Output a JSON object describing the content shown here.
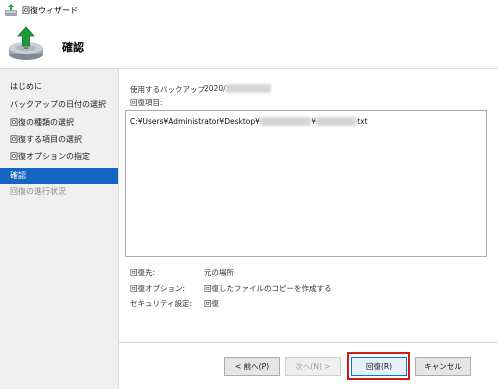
{
  "window": {
    "title": "回復ウィザード"
  },
  "header": {
    "title": "確認"
  },
  "nav": {
    "items": [
      {
        "label": "はじめに"
      },
      {
        "label": "バックアップの日付の選択"
      },
      {
        "label": "回復の種類の選択"
      },
      {
        "label": "回復する項目の選択"
      },
      {
        "label": "回復オプションの指定"
      },
      {
        "label": "確認"
      },
      {
        "label": "回復の進行状況"
      }
    ],
    "active_index": 5
  },
  "details": {
    "backup_used_label": "使用するバックアップ:",
    "backup_used_value": "2020/",
    "restore_items_label": "回復項目:",
    "restore_item_path_start": "C:¥Users¥Administrator¥Desktop¥",
    "restore_item_path_end": "txt",
    "restore_dest_label": "回復先:",
    "restore_dest_value": "元の場所",
    "restore_option_label": "回復オプション:",
    "restore_option_value": "回復したファイルのコピーを作成する",
    "security_label": "セキュリティ設定:",
    "security_value": "回復"
  },
  "buttons": {
    "prev": "< 前へ(P)",
    "next": "次へ(N) >",
    "restore": "回復(R)",
    "cancel": "キャンセル"
  },
  "colors": {
    "active_nav": "#1565c0",
    "highlight": "#d11a1a"
  }
}
